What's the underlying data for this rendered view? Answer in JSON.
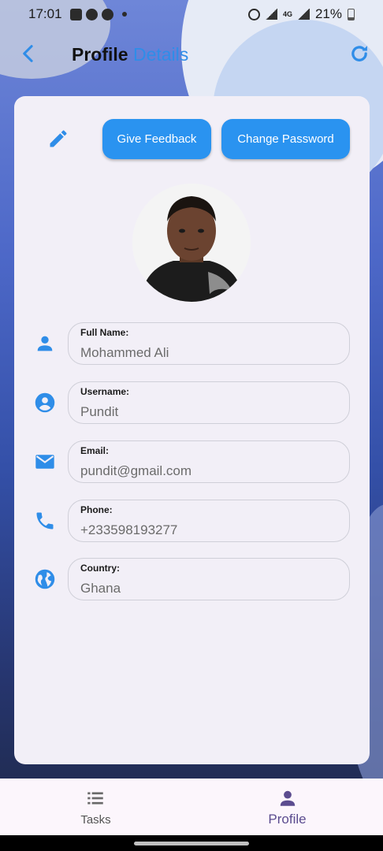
{
  "status_bar": {
    "time": "17:01",
    "network": "4G",
    "battery": "21%"
  },
  "app_bar": {
    "title_main": "Profile",
    "title_accent": "Details"
  },
  "actions": {
    "feedback_label": "Give Feedback",
    "password_label": "Change Password"
  },
  "profile": {
    "fields": [
      {
        "label": "Full Name:",
        "value": "Mohammed Ali",
        "icon": "person-icon"
      },
      {
        "label": "Username:",
        "value": "Pundit",
        "icon": "account-circle-icon"
      },
      {
        "label": "Email:",
        "value": "pundit@gmail.com",
        "icon": "email-icon"
      },
      {
        "label": "Phone:",
        "value": "+233598193277",
        "icon": "phone-icon"
      },
      {
        "label": "Country:",
        "value": "Ghana",
        "icon": "globe-icon"
      }
    ]
  },
  "bottom_nav": {
    "items": [
      {
        "label": "Tasks",
        "icon": "list-icon",
        "active": false
      },
      {
        "label": "Profile",
        "icon": "person-icon",
        "active": true
      }
    ]
  },
  "colors": {
    "accent": "#2f8de8",
    "button": "#2a93f0",
    "active_nav": "#5b4c8f"
  }
}
